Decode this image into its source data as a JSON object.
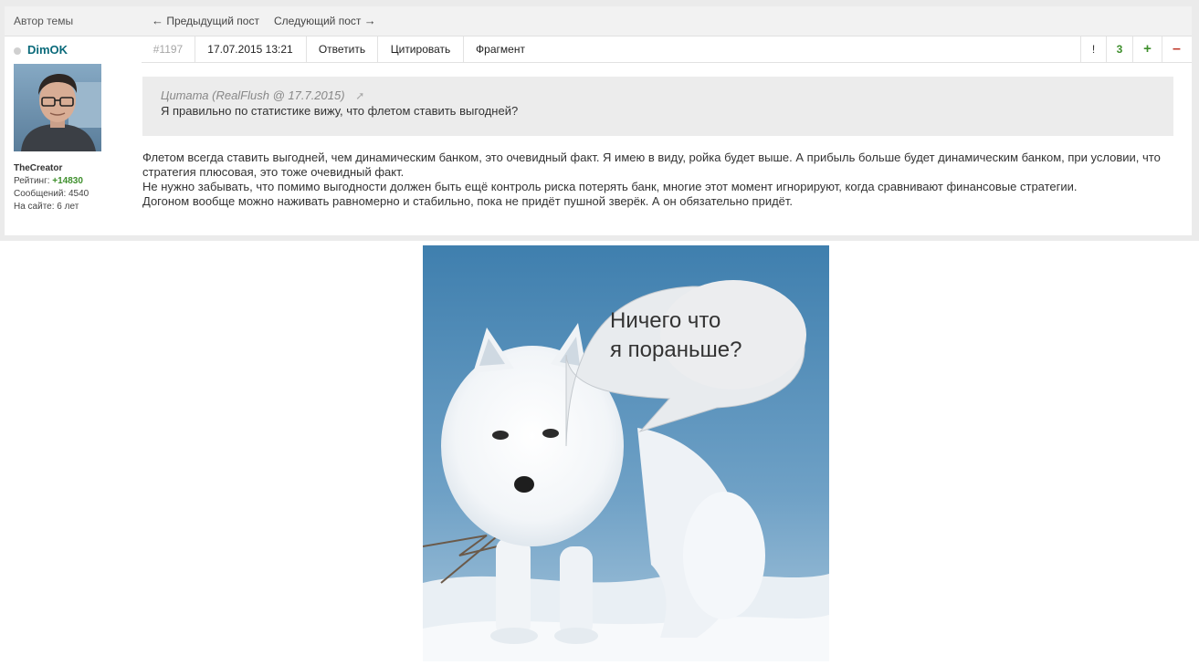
{
  "topbar": {
    "author_label": "Автор темы",
    "prev_post": "Предыдущий пост",
    "next_post": "Следующий пост"
  },
  "user": {
    "name": "DimOK",
    "title": "TheCreator",
    "rating_label": "Рейтинг:",
    "rating_value": "+14830",
    "messages": "Сообщений: 4540",
    "on_site": "На сайте: 6 лет"
  },
  "post_header": {
    "number": "#1197",
    "datetime": "17.07.2015 13:21",
    "reply": "Ответить",
    "quote": "Цитировать",
    "fragment": "Фрагмент",
    "report": "!",
    "votes": "3",
    "plus": "+",
    "minus": "–"
  },
  "quote": {
    "header": "Цитата (RealFlush @ 17.7.2015)",
    "body": "Я правильно по статистике вижу, что флетом ставить выгодней?"
  },
  "post_body": {
    "line1": "Флетом всегда ставить выгодней, чем динамическим банком, это очевидный факт. Я имею в виду, ройка будет выше. А прибыль больше будет динамическим банком, при условии, что стратегия плюсовая, это тоже очевидный факт.",
    "line2": "Не нужно забывать, что помимо выгодности должен быть ещё контроль риска потерять банк, многие этот момент игнорируют, когда сравнивают финансовые стратегии.",
    "line3": "Догоном вообще можно наживать равномерно и стабильно, пока не придёт пушной зверёк. А он обязательно придёт."
  },
  "image": {
    "bubble_line1": "Ничего что",
    "bubble_line2": "я пораньше?"
  },
  "colors": {
    "username": "#0a6a7a",
    "rating": "#3e8f2c",
    "minus": "#c0392b"
  }
}
